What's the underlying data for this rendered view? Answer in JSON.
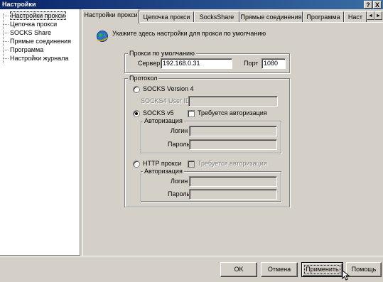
{
  "window": {
    "title": "Настройки",
    "help_label": "?",
    "close_label": "X"
  },
  "tree": {
    "items": [
      {
        "label": "Настройки прокси",
        "selected": true
      },
      {
        "label": "Цепочка прокси"
      },
      {
        "label": "SOCKS Share"
      },
      {
        "label": "Прямые соединения"
      },
      {
        "label": "Программа"
      },
      {
        "label": "Настройки журнала"
      }
    ]
  },
  "tabs": [
    {
      "label": "Настройки прокси",
      "active": true
    },
    {
      "label": "Цепочка прокси"
    },
    {
      "label": "SocksShare"
    },
    {
      "label": "Прямые соединения"
    },
    {
      "label": "Программа"
    },
    {
      "label": "Наст"
    }
  ],
  "tab_scroll": {
    "left": "◄",
    "right": "►"
  },
  "panel": {
    "icon": "globe-icon",
    "heading": "Укажите здесь настройки для прокси по умолчанию",
    "default_proxy": {
      "legend": "Прокси по умолчанию",
      "server_label": "Сервер",
      "server_value": "192.168.0.31",
      "port_label": "Порт",
      "port_value": "1080"
    },
    "protocol": {
      "legend": "Протокол",
      "socks4_label": "SOCKS Version 4",
      "socks4_userid_label": "SOCKS4 User ID",
      "socks5_label": "SOCKS v5",
      "socks5_auth_check_label": "Требуется авторизация",
      "socks5_auth": {
        "legend": "Авторизация",
        "login_label": "Логин",
        "password_label": "Пароль"
      },
      "http_label": "HTTP прокси",
      "http_auth_check_label": "Требуется авторизация",
      "http_auth": {
        "legend": "Авторизация",
        "login_label": "Логин",
        "password_label": "Пароль"
      },
      "selected": "SOCKS v5"
    }
  },
  "buttons": {
    "ok": "OK",
    "cancel": "Отмена",
    "apply": "Применить",
    "help": "Помощь"
  }
}
